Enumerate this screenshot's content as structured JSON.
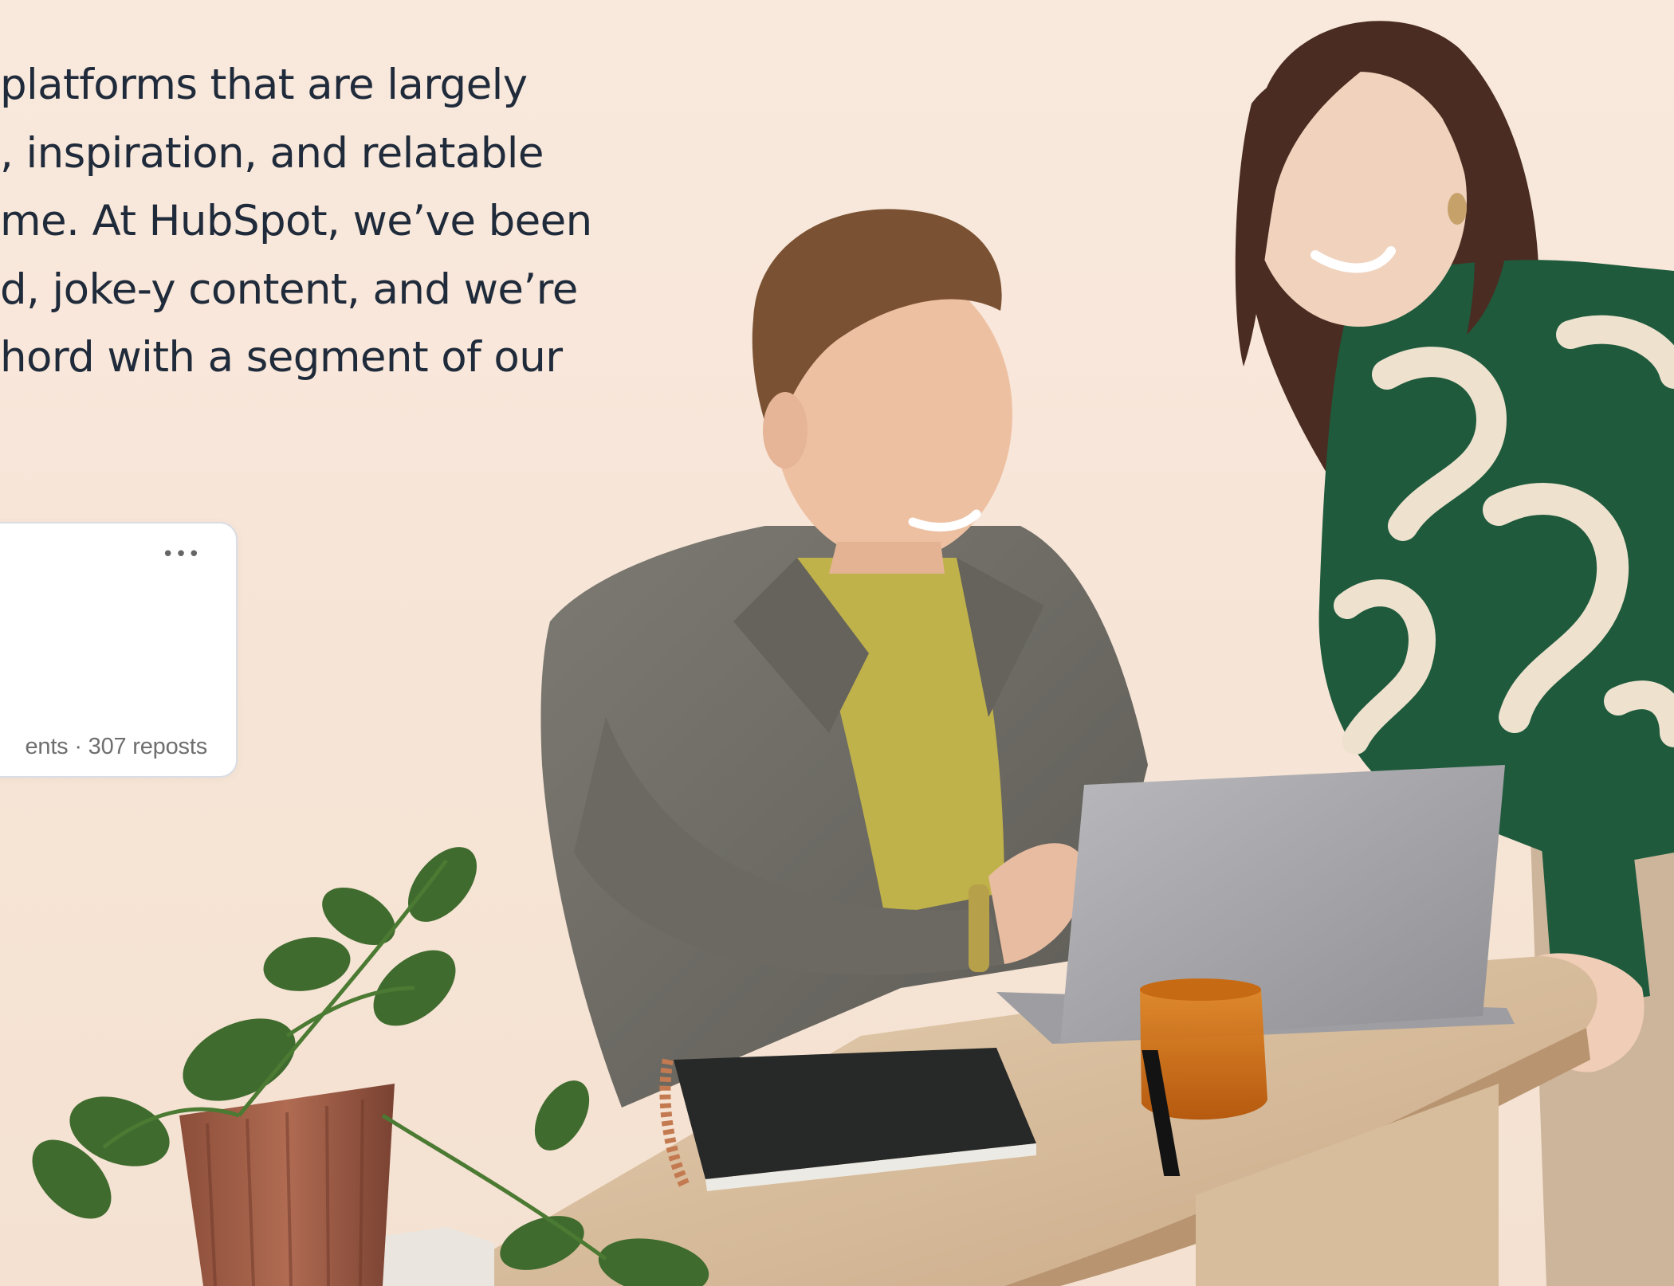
{
  "article": {
    "lines": [
      "platforms that are largely",
      ", inspiration, and relatable",
      "me. At HubSpot, we’ve been",
      "d, joke-y content, and we’re",
      "hord with a segment of our"
    ]
  },
  "post_card": {
    "more_icon": "ellipsis-icon",
    "more_glyph": "•••",
    "stats": "ents · 307 reposts"
  },
  "colors": {
    "background": "#f8e7da",
    "text": "#1f2a3a",
    "card_border": "#d9dde6",
    "jacket": "#6f6d66",
    "sweater_yellow": "#c0b24a",
    "sweater_green": "#1f5a3c",
    "table": "#d8c1a0"
  }
}
